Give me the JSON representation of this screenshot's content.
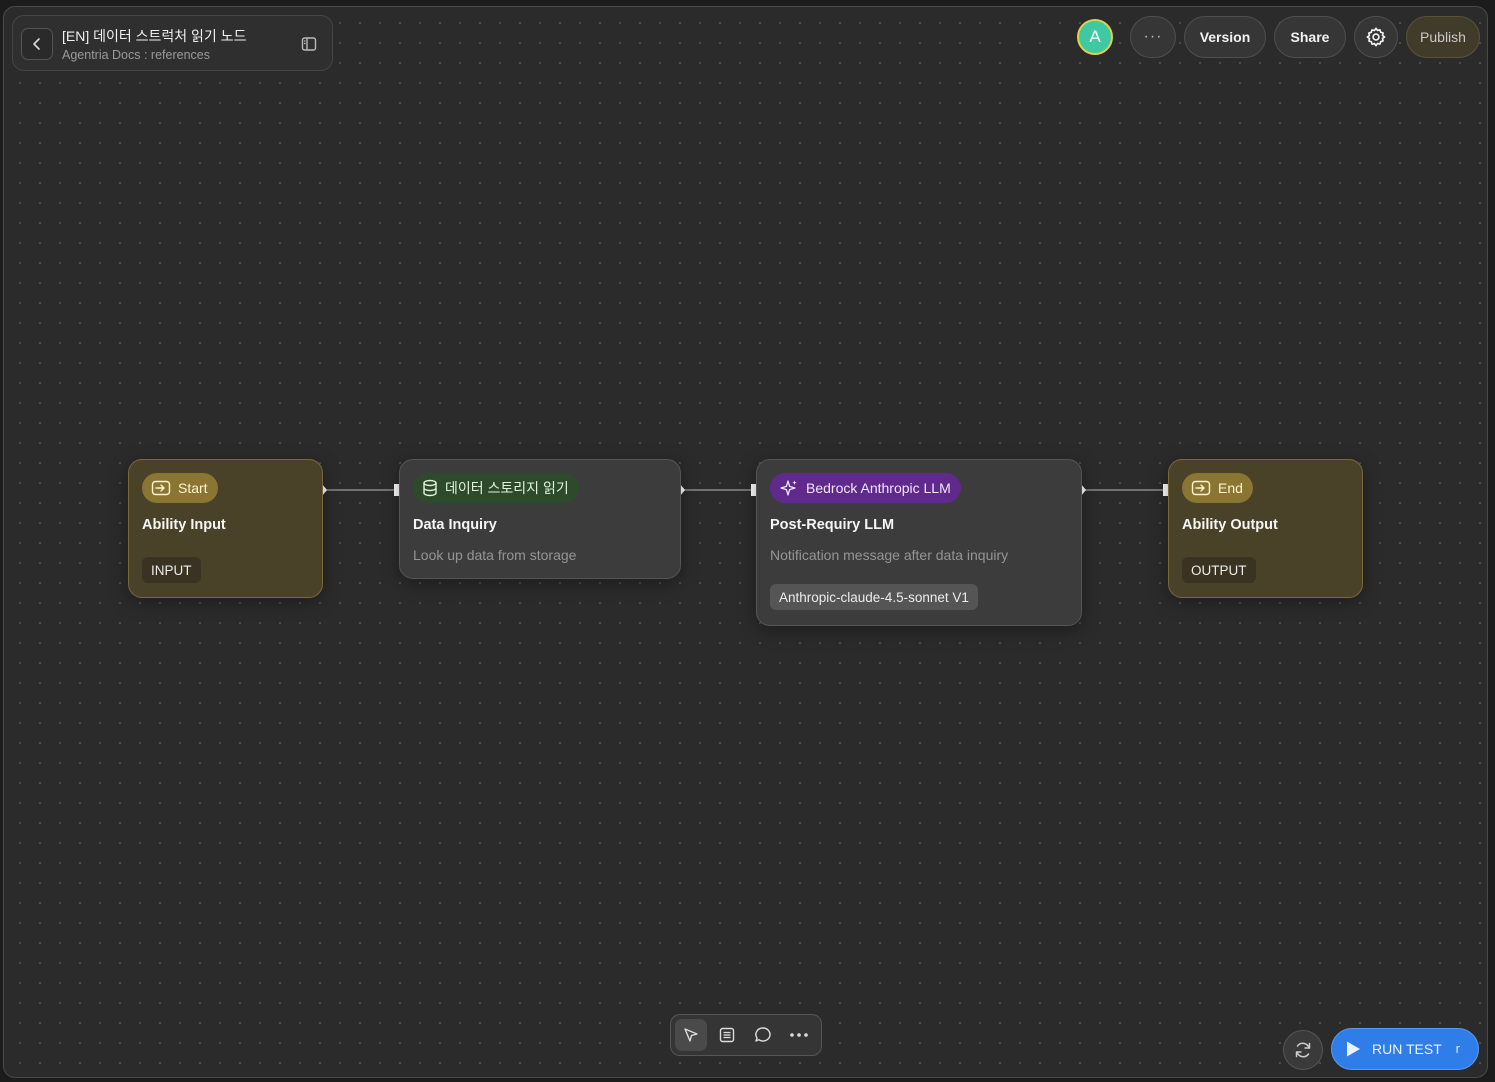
{
  "header": {
    "title": "[EN] 데이터 스트럭처 읽기 노드",
    "subtitle": "Agentria Docs : references"
  },
  "toolbar": {
    "avatar_letter": "A",
    "more_label": "···",
    "version_label": "Version",
    "share_label": "Share",
    "publish_label": "Publish"
  },
  "nodes": [
    {
      "chip": "Start",
      "title": "Ability Input",
      "tag": "INPUT",
      "kind": "io"
    },
    {
      "chip": "데이터 스토리지 읽기",
      "title": "Data Inquiry",
      "description": "Look up data from storage",
      "kind": "data"
    },
    {
      "chip": "Bedrock Anthropic LLM",
      "title": "Post-Requiry LLM",
      "description": "Notification message after data inquiry",
      "tag": "Anthropic-claude-4.5-sonnet V1",
      "kind": "llm"
    },
    {
      "chip": "End",
      "title": "Ability Output",
      "tag": "OUTPUT",
      "kind": "io"
    }
  ],
  "footer": {
    "run_label": "RUN TEST",
    "run_shortcut": "r"
  },
  "colors": {
    "canvas": "#2b2b2b",
    "io_node": "#4a4129",
    "io_chip": "#8a7533",
    "data_chip": "#2d4a2d",
    "llm_chip": "#5f2a8c",
    "run_button": "#2f7de8",
    "avatar": "#3fc9a3"
  }
}
